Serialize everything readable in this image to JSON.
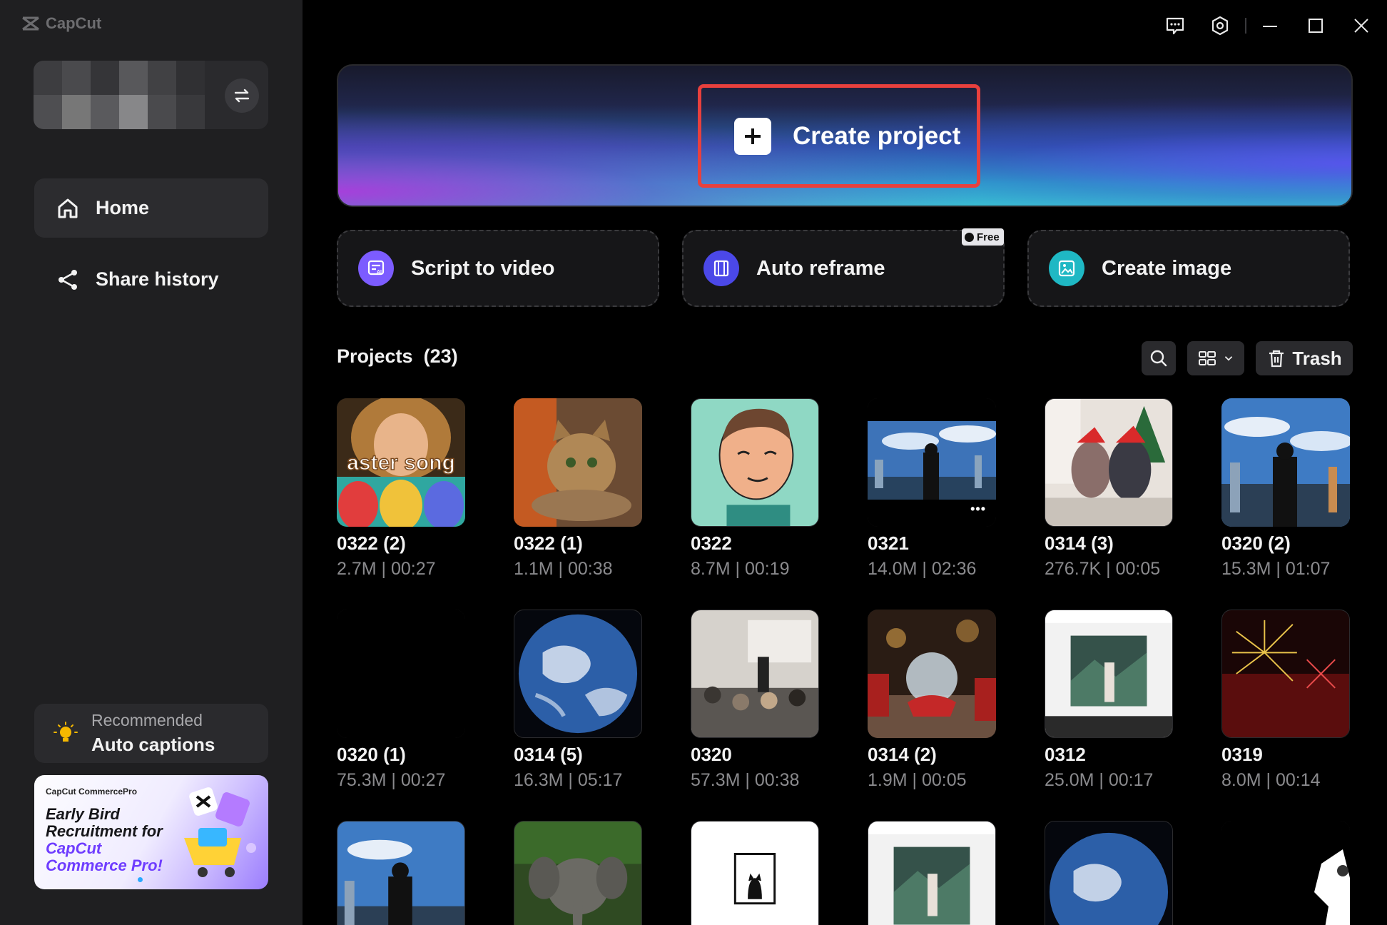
{
  "app": {
    "name": "CapCut"
  },
  "sidebar": {
    "nav": [
      {
        "label": "Home",
        "icon": "home-icon",
        "active": true
      },
      {
        "label": "Share history",
        "icon": "share-icon",
        "active": false
      }
    ],
    "recommend": {
      "small": "Recommended",
      "title": "Auto captions"
    },
    "promo": {
      "brand": "CapCut CommercePro",
      "lines": [
        "Early Bird",
        "Recruitment for",
        "CapCut",
        "Commerce Pro!"
      ]
    }
  },
  "hero": {
    "create_label": "Create project"
  },
  "features": [
    {
      "label": "Script to video",
      "icon": "script-ai-icon",
      "color": "#7c5cff"
    },
    {
      "label": "Auto reframe",
      "icon": "reframe-icon",
      "color": "#4b48e8",
      "badge": "Free"
    },
    {
      "label": "Create image",
      "icon": "image-icon",
      "color": "#1fb8c4"
    }
  ],
  "projects": {
    "title": "Projects",
    "count": "(23)",
    "trash_label": "Trash",
    "items": [
      {
        "name": "0322 (2)",
        "meta": "2.7M | 00:27",
        "overlay": "aster song"
      },
      {
        "name": "0322 (1)",
        "meta": "1.1M | 00:38"
      },
      {
        "name": "0322",
        "meta": "8.7M | 00:19"
      },
      {
        "name": "0321",
        "meta": "14.0M | 02:36",
        "dots": "•••"
      },
      {
        "name": "0314 (3)",
        "meta": "276.7K | 00:05"
      },
      {
        "name": "0320 (2)",
        "meta": "15.3M | 01:07"
      },
      {
        "name": "0320 (1)",
        "meta": "75.3M | 00:27"
      },
      {
        "name": "0314 (5)",
        "meta": "16.3M | 05:17"
      },
      {
        "name": "0320",
        "meta": "57.3M | 00:38"
      },
      {
        "name": "0314 (2)",
        "meta": "1.9M | 00:05"
      },
      {
        "name": "0312",
        "meta": "25.0M | 00:17"
      },
      {
        "name": "0319",
        "meta": "8.0M | 00:14"
      },
      {
        "name": "",
        "meta": ""
      },
      {
        "name": "",
        "meta": ""
      },
      {
        "name": "",
        "meta": ""
      },
      {
        "name": "",
        "meta": ""
      },
      {
        "name": "",
        "meta": ""
      },
      {
        "name": "",
        "meta": ""
      }
    ]
  },
  "colors": {
    "highlight": "#e8403d",
    "sidebar_bg": "#1f1f21",
    "meta_text": "#8a8a8d"
  }
}
